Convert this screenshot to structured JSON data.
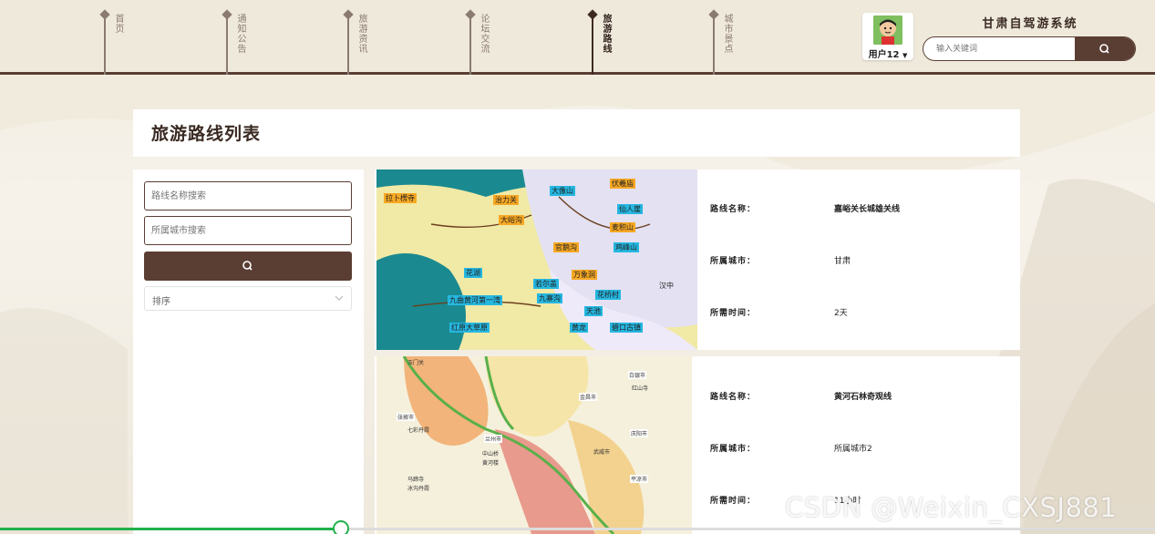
{
  "nav": {
    "items": [
      {
        "label": "首页",
        "active": false
      },
      {
        "label": "通知公告",
        "active": false
      },
      {
        "label": "旅游资讯",
        "active": false
      },
      {
        "label": "论坛交流",
        "active": false
      },
      {
        "label": "旅游路线",
        "active": true
      },
      {
        "label": "城市景点",
        "active": false
      }
    ]
  },
  "user": {
    "name": "用户12"
  },
  "site": {
    "title": "甘肃自驾游系统"
  },
  "search": {
    "placeholder": "输入关键词"
  },
  "page": {
    "title": "旅游路线列表"
  },
  "filter": {
    "route_name_placeholder": "路线名称搜索",
    "city_placeholder": "所属城市搜索",
    "sort_label": "排序"
  },
  "routes": [
    {
      "name_label": "路线名称：",
      "name": "嘉峪关长城雄关线",
      "city_label": "所属城市：",
      "city": "甘肃",
      "time_label": "所需时间：",
      "time": "2天"
    },
    {
      "name_label": "路线名称：",
      "name": "黄河石林奇观线",
      "city_label": "所属城市：",
      "city": "所属城市2",
      "time_label": "所需时间：",
      "time": "11小时"
    }
  ],
  "map_labels": {
    "card1": [
      "拉卜楞寺",
      "九曲黄河第一湾",
      "红原大草原",
      "九寨沟",
      "天池",
      "黄龙",
      "碧口古镇",
      "花桥村",
      "万象洞",
      "官鹅沟",
      "若尔盖",
      "花湖",
      "大峪沟",
      "治力关",
      "伏羲庙",
      "仙人崖",
      "鸡峰山",
      "麦积山",
      "汉中",
      "大像山"
    ],
    "card2": [
      "玉门关",
      "七彩丹霞",
      "兰州市",
      "白银市",
      "张掖市",
      "金昌市",
      "武威市",
      "红山寺",
      "中山桥",
      "黄河楼",
      "马蹄寺",
      "冰沟丹霞",
      "庆阳市",
      "平凉市"
    ]
  },
  "watermark": "CSDN @Weixin_CXSJ881",
  "progress": {
    "value": 0.295
  },
  "colors": {
    "brand": "#5a3e33",
    "accent": "#22b14c"
  }
}
